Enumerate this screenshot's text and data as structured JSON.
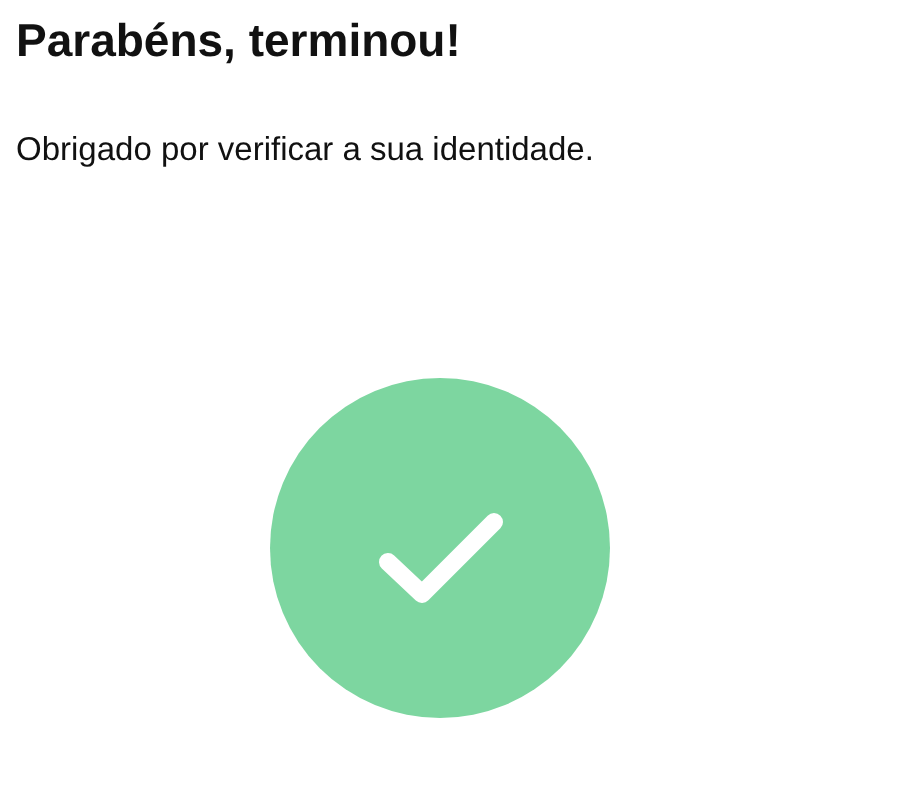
{
  "title": "Parabéns, terminou!",
  "message": "Obrigado por verificar a sua identidade.",
  "status": {
    "kind": "success"
  }
}
